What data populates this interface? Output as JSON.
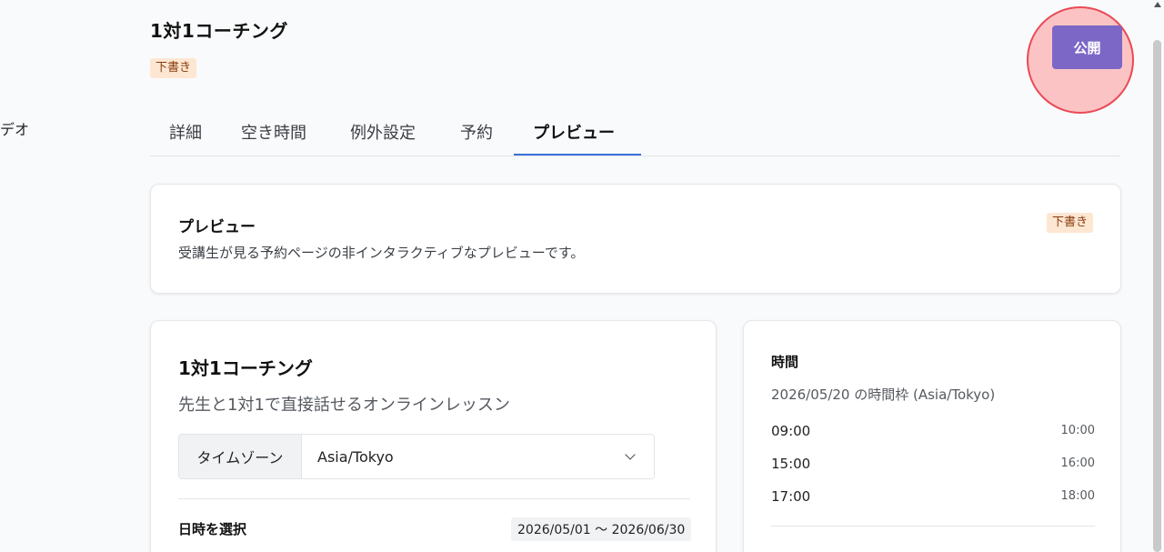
{
  "sidebar": {
    "partial_item": "デオ"
  },
  "header": {
    "title": "1対1コーチング",
    "status_badge": "下書き",
    "publish_button": "公開"
  },
  "tabs": [
    {
      "label": "詳細",
      "active": false
    },
    {
      "label": "空き時間",
      "active": false
    },
    {
      "label": "例外設定",
      "active": false
    },
    {
      "label": "予約",
      "active": false
    },
    {
      "label": "プレビュー",
      "active": true
    }
  ],
  "preview_card": {
    "title": "プレビュー",
    "description": "受講生が見る予約ページの非インタラクティブなプレビューです。",
    "status_badge": "下書き"
  },
  "course_card": {
    "title": "1対1コーチング",
    "subtitle": "先生と1対1で直接話せるオンラインレッスン",
    "timezone_label": "タイムゾーン",
    "timezone_value": "Asia/Tokyo",
    "date_label": "日時を選択",
    "date_range": "2026/05/01 ～ 2026/06/30"
  },
  "time_card": {
    "title": "時間",
    "subtitle": "2026/05/20 の時間枠 (Asia/Tokyo)",
    "slots": [
      {
        "start": "09:00",
        "end": "10:00"
      },
      {
        "start": "15:00",
        "end": "16:00"
      },
      {
        "start": "17:00",
        "end": "18:00"
      }
    ]
  },
  "colors": {
    "accent": "#7c67c6",
    "tab_underline": "#3a6fd8",
    "draft_badge_bg": "#fde7d3",
    "draft_badge_text": "#8a3b0d",
    "highlight_ring": "#ea4a55"
  }
}
